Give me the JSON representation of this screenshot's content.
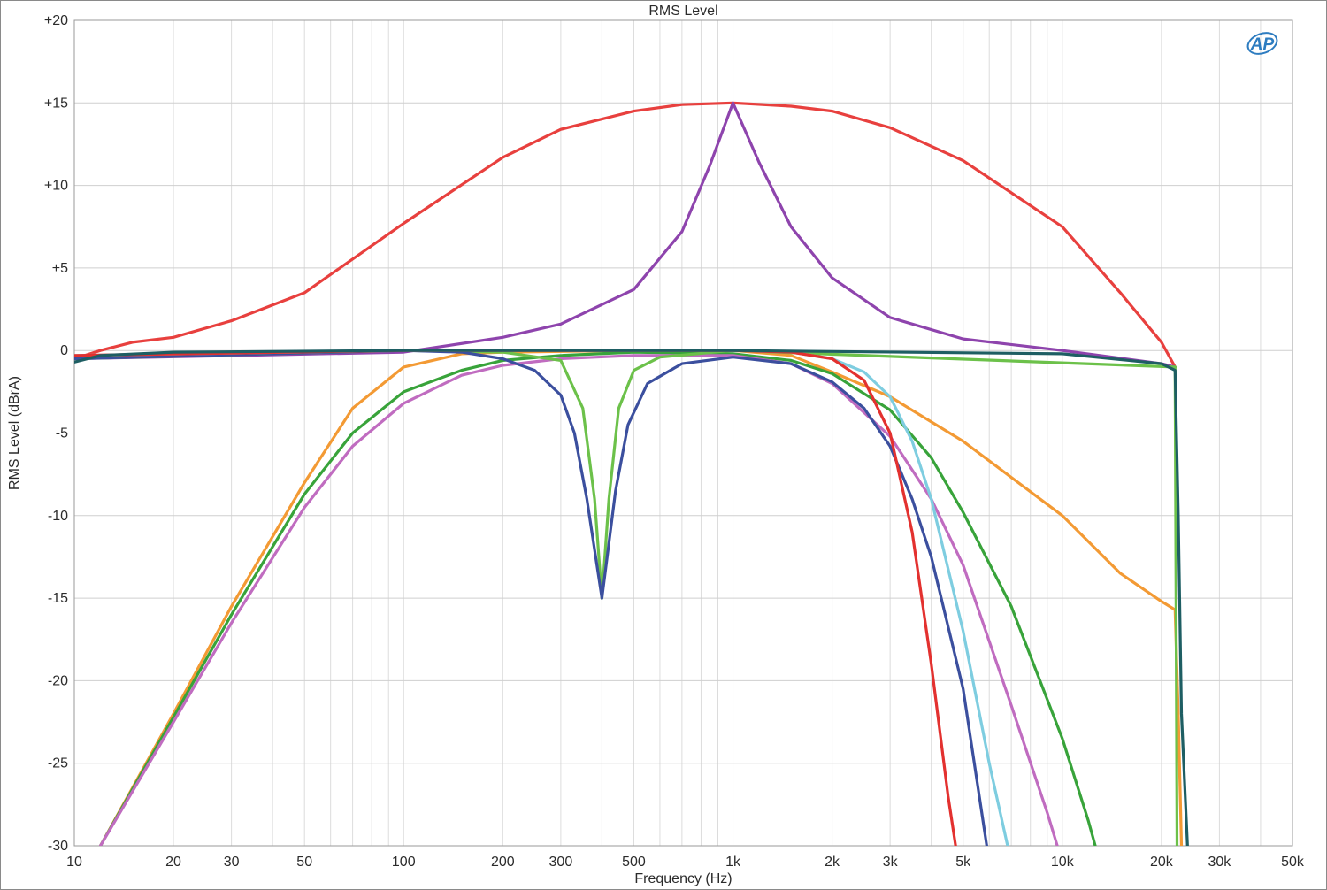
{
  "chart_data": {
    "type": "line",
    "title": "RMS Level",
    "xlabel": "Frequency (Hz)",
    "ylabel": "RMS Level (dBrA)",
    "x_scale": "log",
    "xlim": [
      10,
      50000
    ],
    "ylim": [
      -30,
      20
    ],
    "grid": true,
    "logo": "AP",
    "x_ticks": [
      {
        "value": 10,
        "label": "10"
      },
      {
        "value": 20,
        "label": "20"
      },
      {
        "value": 30,
        "label": "30"
      },
      {
        "value": 50,
        "label": "50"
      },
      {
        "value": 100,
        "label": "100"
      },
      {
        "value": 200,
        "label": "200"
      },
      {
        "value": 300,
        "label": "300"
      },
      {
        "value": 500,
        "label": "500"
      },
      {
        "value": 1000,
        "label": "1k"
      },
      {
        "value": 2000,
        "label": "2k"
      },
      {
        "value": 3000,
        "label": "3k"
      },
      {
        "value": 5000,
        "label": "5k"
      },
      {
        "value": 10000,
        "label": "10k"
      },
      {
        "value": 20000,
        "label": "20k"
      },
      {
        "value": 30000,
        "label": "30k"
      },
      {
        "value": 50000,
        "label": "50k"
      }
    ],
    "y_ticks": [
      {
        "value": 20,
        "label": "+20"
      },
      {
        "value": 15,
        "label": "+15"
      },
      {
        "value": 10,
        "label": "+10"
      },
      {
        "value": 5,
        "label": "+5"
      },
      {
        "value": 0,
        "label": "0"
      },
      {
        "value": -5,
        "label": "-5"
      },
      {
        "value": -10,
        "label": "-10"
      },
      {
        "value": -15,
        "label": "-15"
      },
      {
        "value": -20,
        "label": "-20"
      },
      {
        "value": -25,
        "label": "-25"
      },
      {
        "value": -30,
        "label": "-30"
      }
    ],
    "series": [
      {
        "color": "#e8403e",
        "x": [
          10,
          12,
          15,
          20,
          30,
          50,
          100,
          200,
          300,
          500,
          700,
          1000,
          1500,
          2000,
          3000,
          5000,
          10000,
          15000,
          20000,
          22000
        ],
        "y": [
          -0.5,
          0,
          0.5,
          0.8,
          1.8,
          3.5,
          7.7,
          11.7,
          13.4,
          14.5,
          14.9,
          15,
          14.8,
          14.5,
          13.5,
          11.5,
          7.5,
          3.5,
          0.5,
          -1
        ]
      },
      {
        "color": "#8e44ad",
        "x": [
          10,
          100,
          200,
          300,
          500,
          700,
          850,
          1000,
          1200,
          1500,
          2000,
          3000,
          5000,
          10000,
          20000,
          22000
        ],
        "y": [
          -0.5,
          -0.1,
          0.8,
          1.6,
          3.7,
          7.2,
          11.2,
          15,
          11.4,
          7.5,
          4.4,
          2.0,
          0.7,
          0,
          -0.8,
          -1
        ]
      },
      {
        "color": "#f39a34",
        "x": [
          10,
          12,
          20,
          30,
          50,
          70,
          100,
          150,
          200,
          500,
          1000,
          1500,
          2000,
          3000,
          5000,
          10000,
          15000,
          20000,
          22000,
          22500,
          23000
        ],
        "y": [
          -34,
          -30,
          -22,
          -15.5,
          -8,
          -3.5,
          -1,
          -0.2,
          -0.1,
          0,
          0,
          -0.3,
          -1.3,
          -2.8,
          -5.5,
          -10,
          -13.5,
          -15.2,
          -15.7,
          -22,
          -30
        ]
      },
      {
        "color": "#38a33a",
        "x": [
          10,
          12,
          20,
          30,
          50,
          70,
          100,
          150,
          200,
          300,
          500,
          1000,
          1500,
          2000,
          3000,
          4000,
          5000,
          7000,
          10000,
          12000,
          13000
        ],
        "y": [
          -34,
          -30,
          -22.2,
          -16,
          -8.7,
          -5,
          -2.5,
          -1.2,
          -0.6,
          -0.3,
          -0.1,
          -0.2,
          -0.6,
          -1.4,
          -3.6,
          -6.5,
          -9.8,
          -15.5,
          -23.5,
          -28.5,
          -31
        ]
      },
      {
        "color": "#c06cc0",
        "x": [
          10,
          12,
          20,
          30,
          50,
          70,
          100,
          150,
          200,
          300,
          500,
          1000,
          1500,
          2000,
          3000,
          4000,
          5000,
          7000,
          9000,
          10000
        ],
        "y": [
          -34,
          -30,
          -22.5,
          -16.5,
          -9.5,
          -5.8,
          -3.2,
          -1.5,
          -0.9,
          -0.5,
          -0.3,
          -0.3,
          -0.8,
          -2,
          -5.2,
          -9,
          -13,
          -21.5,
          -28,
          -31
        ]
      },
      {
        "color": "#6cc14a",
        "x": [
          10,
          100,
          200,
          300,
          350,
          380,
          400,
          420,
          450,
          500,
          600,
          1000,
          22000,
          22300
        ],
        "y": [
          -0.5,
          0,
          -0.1,
          -0.6,
          -3.5,
          -9,
          -15,
          -9,
          -3.5,
          -1.2,
          -0.4,
          0,
          -1,
          -30
        ]
      },
      {
        "color": "#3b4f9e",
        "x": [
          10,
          100,
          150,
          200,
          250,
          300,
          330,
          360,
          400,
          440,
          480,
          550,
          700,
          1000,
          1500,
          2000,
          2500,
          3000,
          3500,
          4000,
          5000,
          6000
        ],
        "y": [
          -0.5,
          0,
          -0.1,
          -0.5,
          -1.2,
          -2.7,
          -5,
          -9,
          -15,
          -8.5,
          -4.5,
          -2,
          -0.8,
          -0.4,
          -0.8,
          -1.9,
          -3.5,
          -5.8,
          -9,
          -12.5,
          -20.5,
          -31
        ]
      },
      {
        "color": "#7ecde0",
        "x": [
          10,
          100,
          1000,
          1500,
          2000,
          2500,
          3000,
          3500,
          4000,
          5000,
          6000,
          7000
        ],
        "y": [
          -0.3,
          0,
          0,
          -0.1,
          -0.5,
          -1.3,
          -2.8,
          -5.5,
          -9,
          -17,
          -25,
          -31
        ]
      },
      {
        "color": "#e3312f",
        "x": [
          10,
          100,
          1000,
          1500,
          2000,
          2500,
          3000,
          3500,
          4000,
          4500,
          5000
        ],
        "y": [
          -0.3,
          0,
          0,
          -0.1,
          -0.5,
          -1.8,
          -5,
          -11,
          -19,
          -27,
          -33
        ]
      },
      {
        "color": "#1e5e63",
        "x": [
          10,
          12,
          20,
          100,
          1000,
          10000,
          20000,
          22000,
          22500,
          23000,
          24000
        ],
        "y": [
          -0.7,
          -0.3,
          -0.1,
          0,
          0,
          -0.2,
          -0.8,
          -1.2,
          -10,
          -22,
          -30
        ]
      }
    ]
  }
}
